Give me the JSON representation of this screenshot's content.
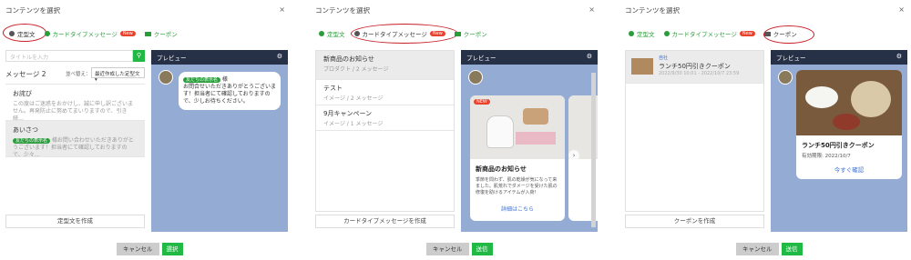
{
  "dialog_title": "コンテンツを選択",
  "close": "×",
  "tabs": {
    "template": "定型文",
    "card": "カードタイプメッセージ",
    "new": "New",
    "coupon": "クーポン"
  },
  "preview_label": "プレビュー",
  "p1": {
    "search_placeholder": "タイトルを入力",
    "count_label": "メッセージ 2",
    "sort_label": "並べ替え：",
    "sort_value": "最近作成した定型文",
    "items": [
      {
        "title": "お詫び",
        "sub": "この度はご迷惑をおかけし、誠に申し訳ございません。再発防止に努めてまいりますので、引き続…"
      },
      {
        "title": "あいさつ",
        "badge": "友だちの表示名",
        "sub_after": " 様お問い合わせいただきありがとうございます！担当者にて確認しておりますので、少々…"
      }
    ],
    "create": "定型文を作成",
    "bubble_badge": "友だちの表示名",
    "bubble_after": " 様",
    "bubble_text": "お問合せいただきありがとうございます！担当者にて確認しておりますので、少しお待ちください。"
  },
  "p2": {
    "items": [
      {
        "title": "新商品のお知らせ",
        "sub": "プロダクト / 2 メッセージ"
      },
      {
        "title": "テスト",
        "sub": "イメージ / 2 メッセージ"
      },
      {
        "title": "9月キャンペーン",
        "sub": "イメージ / 1 メッセージ"
      }
    ],
    "create": "カードタイプメッセージを作成",
    "card_badge": "NEW",
    "card_title": "新商品のお知らせ",
    "card_text": "季節を問わず、肌の乾燥が気になって来ました。肌荒れでダメージを受けた肌の修復を助けるアイテムが入荷！",
    "card_link": "詳細はこちら"
  },
  "p3": {
    "item_tag": "自社",
    "item_title": "ランチ50円引きクーポン",
    "item_date": "2022/9/30 10:01 - 2022/10/7 23:59",
    "create": "クーポンを作成",
    "coupon_title": "ランチ50円引きクーポン",
    "coupon_valid": "有効期限: 2022/10/7",
    "coupon_link": "今すぐ確認"
  },
  "footer": {
    "cancel": "キャンセル",
    "select": "選択",
    "send": "送信"
  },
  "colors": {
    "green": "#1fb944",
    "header_dark": "#263047",
    "preview_bg": "#94abd4",
    "badge_red": "#e8412c",
    "ring_red": "#c61f26"
  }
}
